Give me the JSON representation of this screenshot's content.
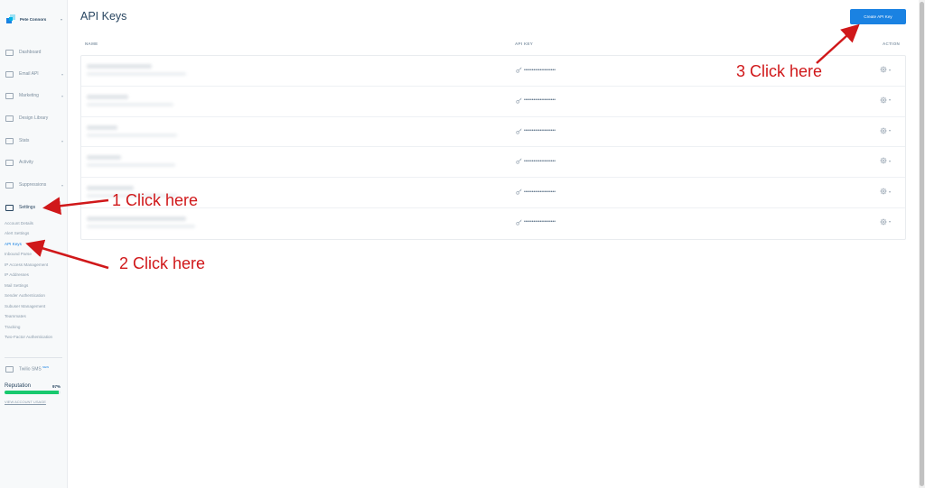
{
  "sidebar": {
    "account_name": "Pete Connors",
    "nav": [
      {
        "label": "Dashboard",
        "icon": "dashboard-icon",
        "has_caret": false
      },
      {
        "label": "Email API",
        "icon": "email-api-icon",
        "has_caret": true
      },
      {
        "label": "Marketing",
        "icon": "marketing-icon",
        "has_caret": true
      },
      {
        "label": "Design Library",
        "icon": "design-library-icon",
        "has_caret": false
      },
      {
        "label": "Stats",
        "icon": "stats-icon",
        "has_caret": true
      },
      {
        "label": "Activity",
        "icon": "activity-icon",
        "has_caret": false
      },
      {
        "label": "Suppressions",
        "icon": "suppressions-icon",
        "has_caret": true
      },
      {
        "label": "Settings",
        "icon": "settings-icon",
        "has_caret": false
      }
    ],
    "settings_sub": [
      "Account Details",
      "Alert Settings",
      "API Keys",
      "Inbound Parse",
      "IP Access Management",
      "IP Addresses",
      "Mail Settings",
      "Sender Authentication",
      "Subuser Management",
      "Teammates",
      "Tracking",
      "Two-Factor Authentication"
    ],
    "active_sub": "API Keys",
    "twilio_label": "Twilio SMS",
    "twilio_badge": "NEW",
    "reputation_label": "Reputation",
    "reputation_value": "97%",
    "reputation_fraction": 0.97,
    "view_upgrade": "VIEW ACCOUNT USAGE"
  },
  "main": {
    "title": "API Keys",
    "create_button": "Create API Key",
    "columns": {
      "name": "NAME",
      "api_key": "API KEY",
      "action": "ACTION"
    },
    "rows": [
      {
        "key_mask": "••••••••••••••••••••"
      },
      {
        "key_mask": "••••••••••••••••••••"
      },
      {
        "key_mask": "••••••••••••••••••••"
      },
      {
        "key_mask": "••••••••••••••••••••"
      },
      {
        "key_mask": "••••••••••••••••••••"
      },
      {
        "key_mask": "••••••••••••••••••••"
      }
    ]
  },
  "annotations": {
    "one": "1 Click here",
    "two": "2 Click here",
    "three": "3 Click here"
  },
  "colors": {
    "accent": "#1a82e2",
    "annotation": "#d0181a",
    "reputation": "#18c96e"
  }
}
